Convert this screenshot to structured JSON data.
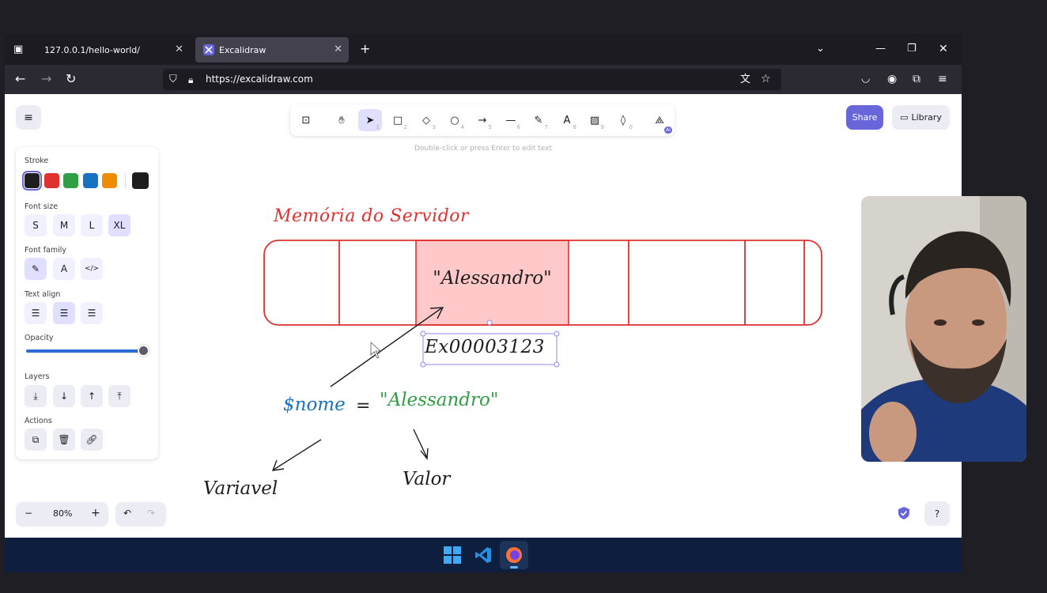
{
  "browser": {
    "tabs": [
      {
        "label": "127.0.0.1/hello-world/"
      },
      {
        "label": "Excalidraw"
      }
    ],
    "url": "https://excalidraw.com"
  },
  "toolbar": {
    "tools": [
      {
        "name": "lock",
        "key": ""
      },
      {
        "name": "hand",
        "key": ""
      },
      {
        "name": "selection",
        "key": "1"
      },
      {
        "name": "rectangle",
        "key": "2"
      },
      {
        "name": "diamond",
        "key": "3"
      },
      {
        "name": "ellipse",
        "key": "4"
      },
      {
        "name": "arrow",
        "key": "5"
      },
      {
        "name": "line",
        "key": "6"
      },
      {
        "name": "draw",
        "key": "7"
      },
      {
        "name": "text",
        "key": "8"
      },
      {
        "name": "image",
        "key": "9"
      },
      {
        "name": "eraser",
        "key": "0"
      },
      {
        "name": "more-tools",
        "key": ""
      }
    ],
    "ai_badge": "AI",
    "hint": "Double-click or press Enter to edit text"
  },
  "top_right": {
    "share": "Share",
    "library": "Library"
  },
  "panel": {
    "stroke_label": "Stroke",
    "stroke_colors": [
      "#1e1e1e",
      "#e03131",
      "#2f9e44",
      "#1971c2",
      "#f08c00"
    ],
    "stroke_current": "#1e1e1e",
    "font_size_label": "Font size",
    "font_sizes": [
      "S",
      "M",
      "L",
      "XL"
    ],
    "font_size_selected": "XL",
    "font_family_label": "Font family",
    "text_align_label": "Text align",
    "opacity_label": "Opacity",
    "opacity_value": 100,
    "layers_label": "Layers",
    "actions_label": "Actions"
  },
  "zoom": {
    "value": "80%",
    "minus": "−",
    "plus": "+"
  },
  "drawing": {
    "title": "Memória do Servidor",
    "cell_value": "\"Alessandro\"",
    "address": "Ex00003123",
    "var_name": "$nome",
    "equals": "=",
    "value_string": "\"Alessandro\"",
    "label_variable": "Variavel",
    "label_value": "Valor",
    "colors": {
      "red": "#e03131",
      "blue": "#1971c2",
      "green": "#2f9e44",
      "highlight": "#ffc9c9"
    }
  }
}
